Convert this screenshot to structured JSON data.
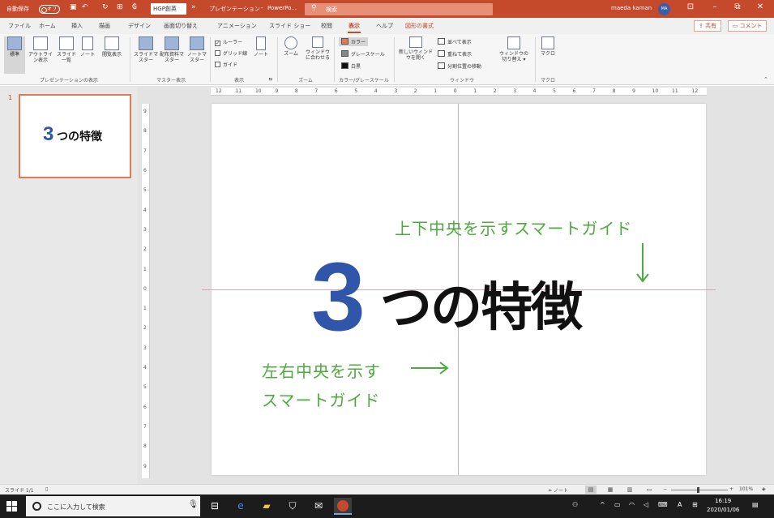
{
  "titlebar": {
    "autosave_label": "自動保存",
    "autosave_state": "オフ",
    "font_box": "HGP創英",
    "doc_title": "プレゼンテーション",
    "app_name": "PowerPo...",
    "search_placeholder": "検索",
    "user_name": "maeda kaman",
    "user_initials": "MA"
  },
  "tabs": [
    "ファイル",
    "ホーム",
    "挿入",
    "描画",
    "デザイン",
    "画面切り替え",
    "アニメーション",
    "スライド ショー",
    "校閲",
    "表示",
    "ヘルプ",
    "図形の書式"
  ],
  "active_tab": "表示",
  "share_label": "共有",
  "comment_label": "コメント",
  "ribbon": {
    "presentation_views": {
      "buttons": [
        {
          "label": "標準"
        },
        {
          "label": "アウトライン表示"
        },
        {
          "label": "スライド一覧"
        },
        {
          "label": "ノート"
        },
        {
          "label": "閲覧表示"
        }
      ],
      "group_label": "プレゼンテーションの表示"
    },
    "master_views": {
      "buttons": [
        {
          "label": "スライドマスター"
        },
        {
          "label": "配布資料マスター"
        },
        {
          "label": "ノートマスター"
        }
      ],
      "group_label": "マスター表示"
    },
    "show": {
      "ruler": "ルーラー",
      "gridlines": "グリッド線",
      "guides": "ガイド",
      "notes": "ノート",
      "group_label": "表示"
    },
    "zoom": {
      "zoom": "ズーム",
      "fit": "ウィンドウに合わせる",
      "group_label": "ズーム"
    },
    "color": {
      "color": "カラー",
      "grayscale": "グレースケール",
      "bw": "白黒",
      "group_label": "カラー/グレースケール"
    },
    "window": {
      "new_window": "新しいウィンドウを開く",
      "arrange_all": "並べて表示",
      "cascade": "重ねて表示",
      "move_split": "分割位置の移動",
      "group_label": "ウィンドウ"
    },
    "switch": {
      "label": "ウィンドウの切り替え"
    },
    "macros": {
      "label": "マクロ",
      "group_label": "マクロ"
    }
  },
  "thumbnail": {
    "number": "1",
    "three": "3",
    "title": "つの特徴"
  },
  "ruler": {
    "h_labels": [
      "12",
      "11",
      "10",
      "9",
      "8",
      "7",
      "6",
      "5",
      "4",
      "3",
      "2",
      "1",
      "0",
      "1",
      "2",
      "3",
      "4",
      "5",
      "6",
      "7",
      "8",
      "9",
      "10",
      "11",
      "12"
    ],
    "v_labels": [
      "9",
      "8",
      "7",
      "6",
      "5",
      "4",
      "3",
      "2",
      "1",
      "0",
      "1",
      "2",
      "3",
      "4",
      "5",
      "6",
      "7",
      "8",
      "9"
    ]
  },
  "slide": {
    "three": "3",
    "title": "つの特徴"
  },
  "annotations": {
    "vertical_guide": "上下中央を示すスマートガイド",
    "horizontal_guide_line1": "左右中央を示す",
    "horizontal_guide_line2": "スマートガイド"
  },
  "status": {
    "slide_info": "スライド 1/1",
    "notes": "ノート",
    "zoom": "101%"
  },
  "taskbar": {
    "search_placeholder": "ここに入力して検索",
    "time": "16:19",
    "date": "2020/01/06",
    "ime": "A"
  },
  "colors": {
    "accent": "#c5492b",
    "blue": "#2f56a8",
    "annotation_green": "#4eaa3f"
  }
}
